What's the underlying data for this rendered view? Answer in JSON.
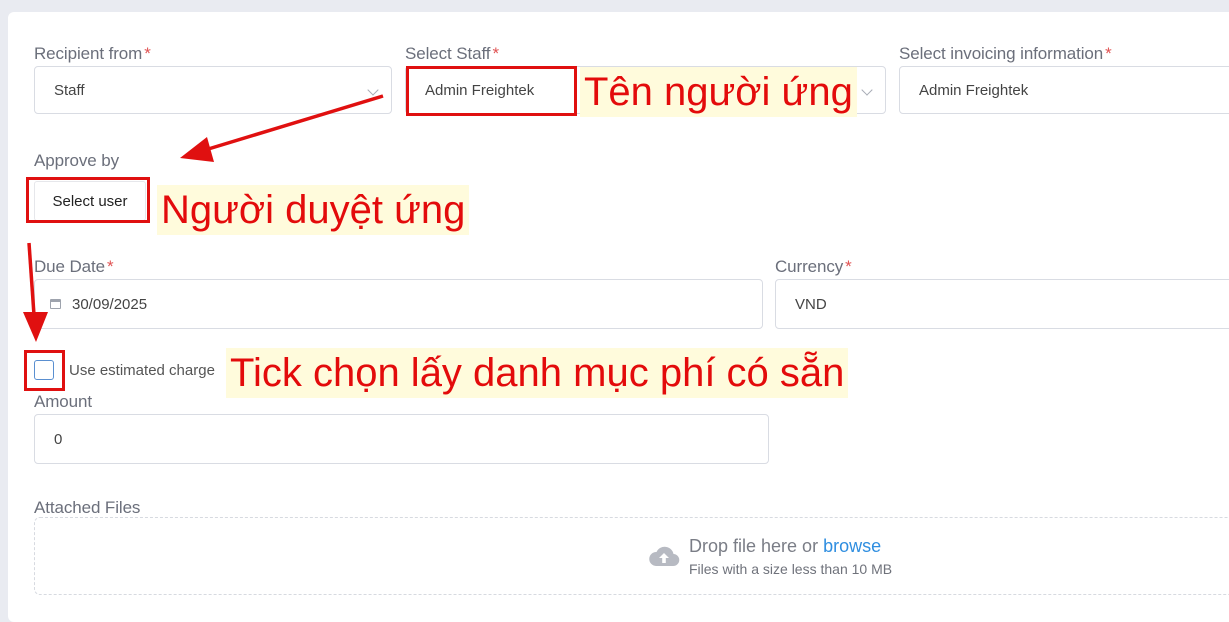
{
  "form": {
    "recipient_from": {
      "label": "Recipient from",
      "required_mark": "*",
      "value": "Staff"
    },
    "select_staff": {
      "label": "Select Staff",
      "required_mark": "*",
      "value": "Admin Freightek"
    },
    "invoicing_info": {
      "label": "Select invoicing information",
      "required_mark": "*",
      "value": "Admin Freightek"
    },
    "approve_by": {
      "label": "Approve by",
      "button_label": "Select user"
    },
    "due_date": {
      "label": "Due Date",
      "required_mark": "*",
      "value": "30/09/2025"
    },
    "currency": {
      "label": "Currency",
      "required_mark": "*",
      "value": "VND"
    },
    "estimated_charge": {
      "label": "Use estimated charge",
      "checked": false
    },
    "amount": {
      "label": "Amount",
      "value": "0"
    },
    "attached_files": {
      "label": "Attached Files",
      "drop_text": "Drop file here or",
      "browse_text": "browse",
      "size_hint": "Files with a size less than 10 MB"
    }
  },
  "annotations": {
    "staff_note": "Tên người ứng",
    "approver_note": "Người duyệt ứng",
    "checkbox_note": "Tick chọn lấy danh mục phí có sẵn"
  },
  "colors": {
    "annotation_red": "#e01010",
    "annotation_highlight": "#fffbdc",
    "link_blue": "#2f8ee0",
    "required_red": "#e05252"
  },
  "icons": [
    "chevron-down-icon",
    "calendar-icon",
    "cloud-upload-icon"
  ]
}
